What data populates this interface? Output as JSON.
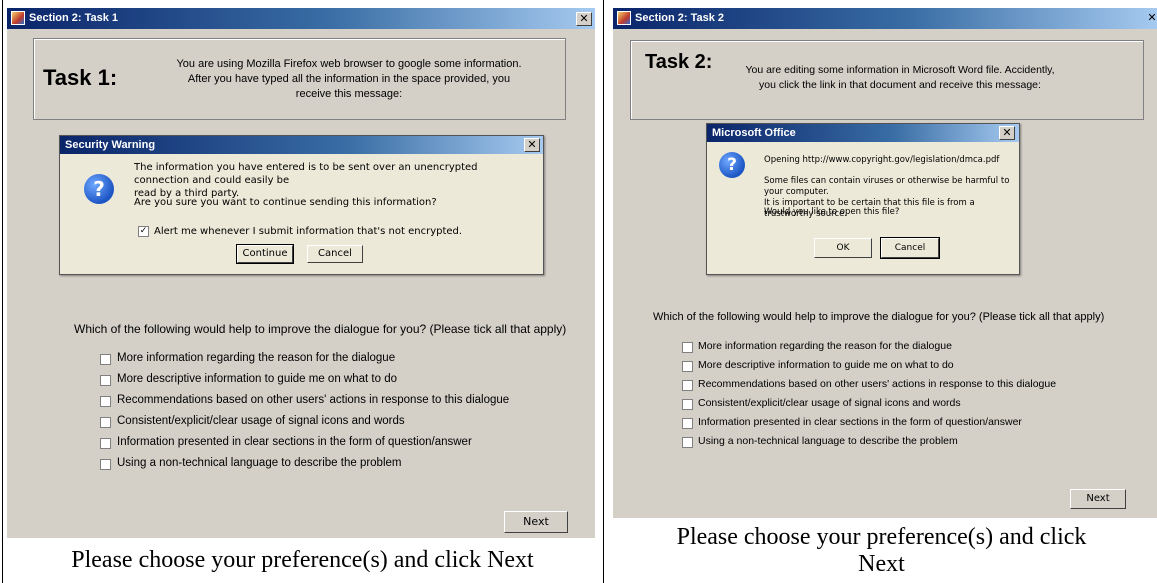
{
  "left": {
    "window_title": "Section 2: Task 1",
    "task_title": "Task 1:",
    "task_lines": [
      "You are using Mozilla Firefox web browser to google some information.",
      "After you have typed all the information in the space provided, you",
      "receive this message:"
    ],
    "dialog": {
      "title": "Security Warning",
      "message_lines": [
        "The information you have entered is to be sent over an unencrypted connection and could easily be",
        "read by a third party."
      ],
      "question": "Are you sure you want to continue sending this information?",
      "checkbox_label": "Alert me whenever I submit information that's not encrypted.",
      "checkbox_checked": true,
      "continue_label": "Continue",
      "cancel_label": "Cancel"
    },
    "question": "Which of the following would help to improve the dialogue for you? (Please tick all that apply)",
    "options": [
      "More information regarding the reason for the dialogue",
      "More descriptive information to guide me on what to do",
      "Recommendations based on other users' actions in response to this dialogue",
      "Consistent/explicit/clear usage of signal icons and words",
      "Information presented in clear sections in the form of question/answer",
      "Using a non-technical language to describe the problem"
    ],
    "next_label": "Next",
    "caption": "Please choose your preference(s) and click Next"
  },
  "right": {
    "window_title": "Section 2: Task 2",
    "task_title": "Task 2:",
    "task_lines": [
      "You are editing some information in Microsoft Word file. Accidently,",
      "you click the link in that document and receive this message:"
    ],
    "dialog": {
      "title": "Microsoft Office",
      "opening": "Opening http://www.copyright.gov/legislation/dmca.pdf",
      "message_lines": [
        "Some files can contain viruses or otherwise be harmful to your computer.",
        "It is important to be certain that this file is from a trustworthy source."
      ],
      "question": "Would you like to open this file?",
      "ok_label": "OK",
      "cancel_label": "Cancel"
    },
    "question": "Which of the following would help to improve the dialogue for you? (Please tick all that apply)",
    "options": [
      "More information regarding the reason for the dialogue",
      "More descriptive information to guide me on what to do",
      "Recommendations based on other users' actions in response to this dialogue",
      "Consistent/explicit/clear usage of signal icons and words",
      "Information presented in clear sections in the form of question/answer",
      "Using a non-technical language to describe the problem"
    ],
    "next_label": "Next",
    "caption_lines": [
      "Please choose your preference(s) and click",
      "Next"
    ]
  },
  "icons": {
    "close": "✕",
    "check": "✓",
    "question": "?"
  }
}
